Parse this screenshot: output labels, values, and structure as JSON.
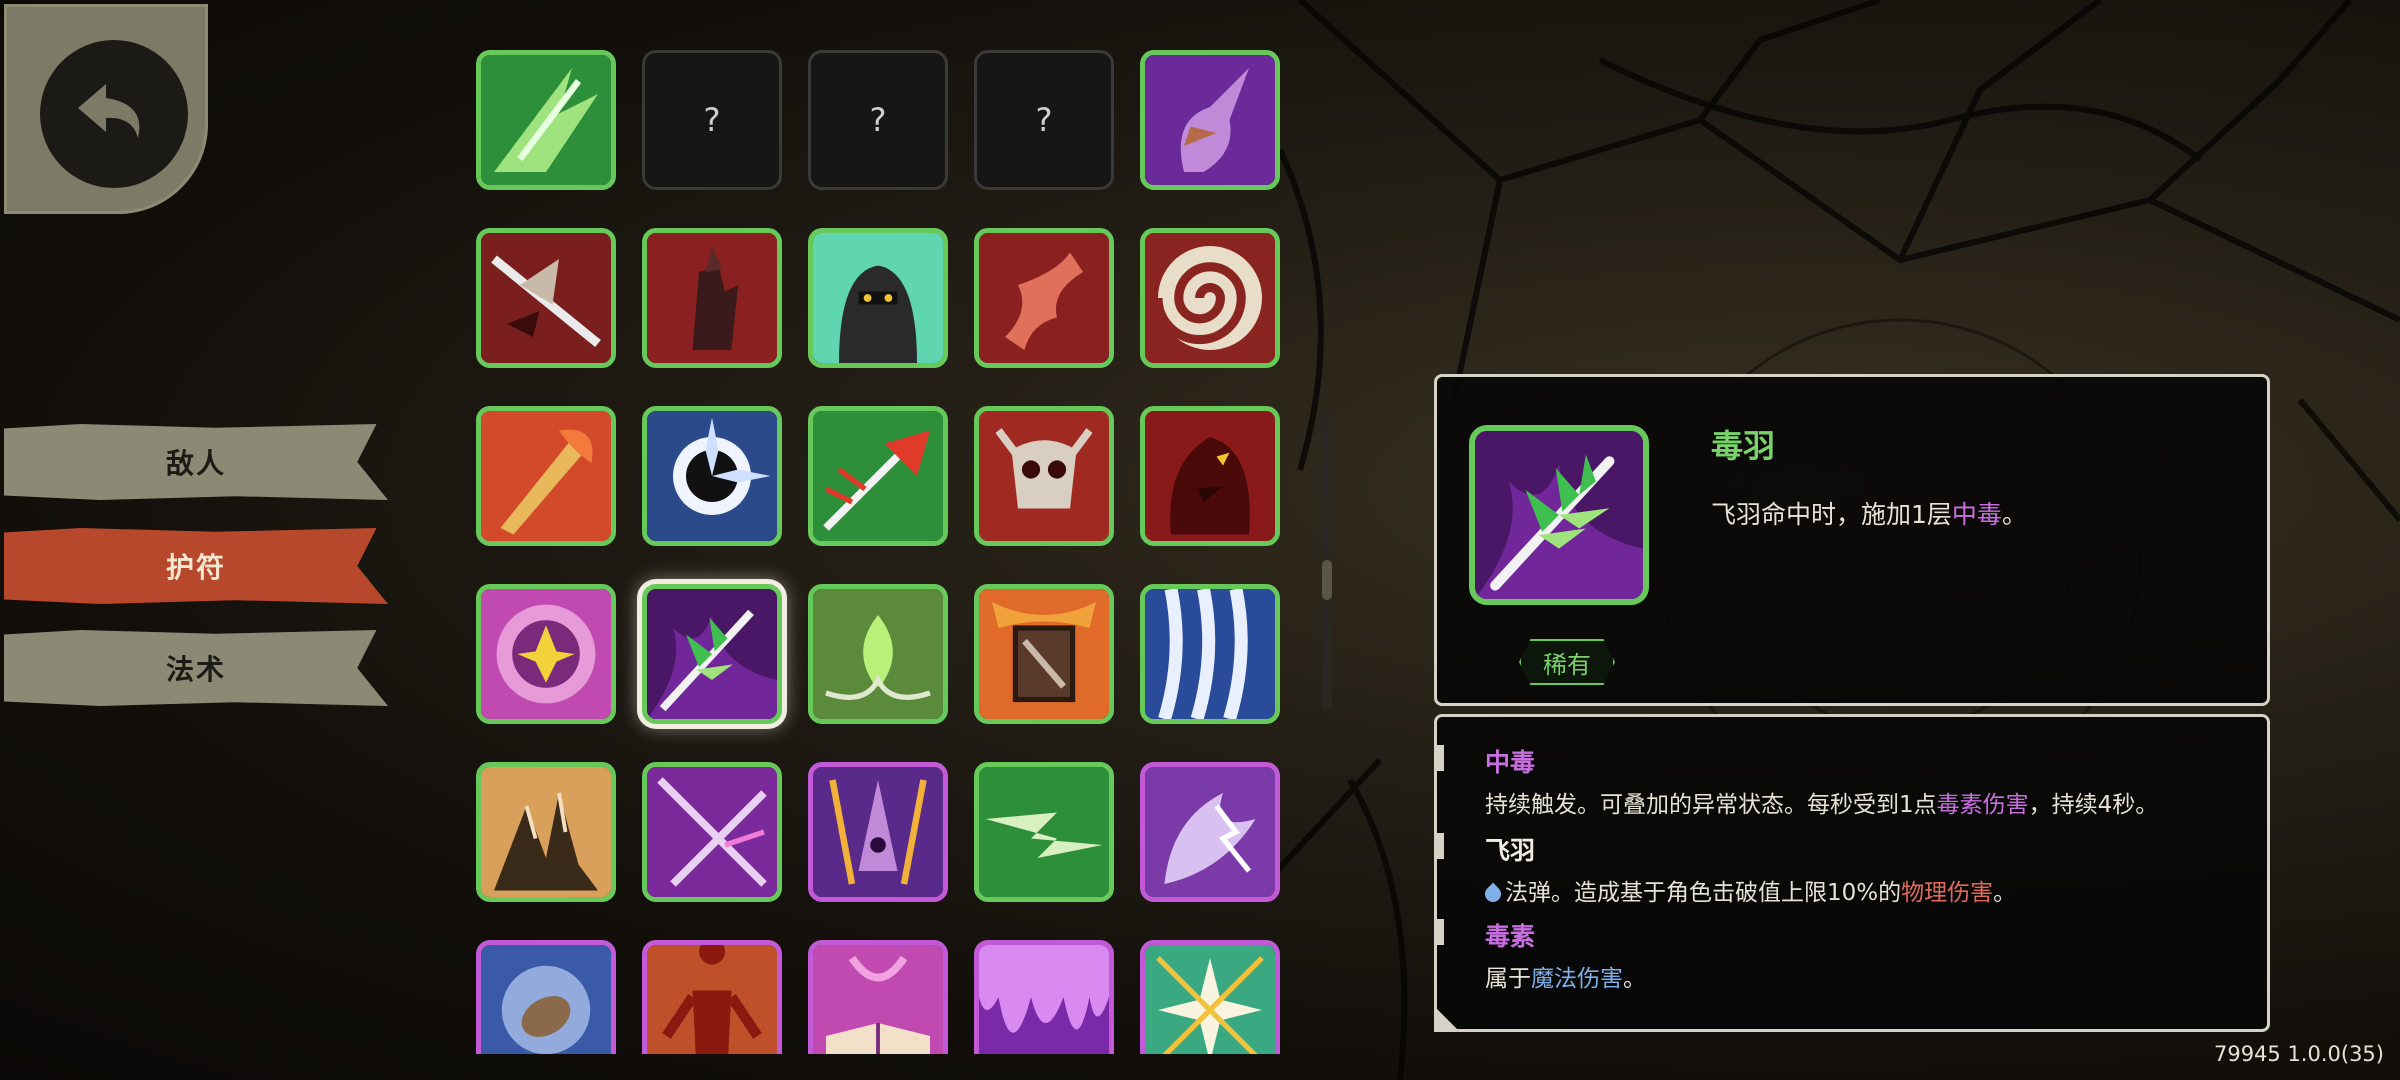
{
  "tabs": [
    {
      "label": "敌人",
      "active": false
    },
    {
      "label": "护符",
      "active": true
    },
    {
      "label": "法术",
      "active": false
    }
  ],
  "grid": {
    "unknown_label": "?",
    "rows": [
      [
        {
          "kind": "icon",
          "border": "green",
          "icon": "green-claw-icon"
        },
        {
          "kind": "unknown"
        },
        {
          "kind": "unknown"
        },
        {
          "kind": "unknown"
        },
        {
          "kind": "icon",
          "border": "green",
          "icon": "purple-hand-icon"
        }
      ],
      [
        {
          "kind": "icon",
          "border": "green",
          "icon": "blade-slash-icon"
        },
        {
          "kind": "icon",
          "border": "green",
          "icon": "dark-hand-icon"
        },
        {
          "kind": "icon",
          "border": "green",
          "icon": "masked-assassin-icon"
        },
        {
          "kind": "icon",
          "border": "green",
          "icon": "twisted-bone-icon"
        },
        {
          "kind": "icon",
          "border": "green",
          "icon": "spiral-icon"
        }
      ],
      [
        {
          "kind": "icon",
          "border": "green",
          "icon": "flame-sword-icon"
        },
        {
          "kind": "icon",
          "border": "green",
          "icon": "frost-burst-icon"
        },
        {
          "kind": "icon",
          "border": "green",
          "icon": "red-arrow-icon"
        },
        {
          "kind": "icon",
          "border": "green",
          "icon": "demon-skull-icon"
        },
        {
          "kind": "icon",
          "border": "green",
          "icon": "beast-head-icon"
        }
      ],
      [
        {
          "kind": "icon",
          "border": "green",
          "icon": "star-rune-icon"
        },
        {
          "kind": "icon",
          "border": "green",
          "icon": "poison-feather-icon",
          "selected": true
        },
        {
          "kind": "icon",
          "border": "green",
          "icon": "green-flame-icon"
        },
        {
          "kind": "icon",
          "border": "green",
          "icon": "fire-card-icon"
        },
        {
          "kind": "icon",
          "border": "green",
          "icon": "waterfall-icon"
        }
      ],
      [
        {
          "kind": "icon",
          "border": "green",
          "icon": "rock-spike-icon"
        },
        {
          "kind": "icon",
          "border": "green",
          "icon": "crossed-blades-icon"
        },
        {
          "kind": "icon",
          "border": "purple",
          "icon": "arcane-spire-icon"
        },
        {
          "kind": "icon",
          "border": "green",
          "icon": "green-lightning-icon"
        },
        {
          "kind": "icon",
          "border": "purple",
          "icon": "storm-claw-icon"
        }
      ],
      [
        {
          "kind": "icon",
          "border": "purple",
          "icon": "frost-seed-icon"
        },
        {
          "kind": "icon",
          "border": "purple",
          "icon": "flayed-figure-icon"
        },
        {
          "kind": "icon",
          "border": "purple",
          "icon": "spellbook-icon"
        },
        {
          "kind": "icon",
          "border": "purple",
          "icon": "dripping-slime-icon"
        },
        {
          "kind": "icon",
          "border": "purple",
          "icon": "radiant-star-icon"
        }
      ]
    ]
  },
  "detail": {
    "icon": "poison-feather-icon",
    "title": "毒羽",
    "rarity": "稀有",
    "desc_prefix": "飞羽命中时，施加1层",
    "desc_keyword": "中毒",
    "desc_suffix": "。"
  },
  "glossary": {
    "t1": "中毒",
    "d1_prefix": "持续触发。可叠加的异常状态。每秒受到1点",
    "d1_keyword": "毒素伤害",
    "d1_suffix": "，持续4秒。",
    "t2": "飞羽",
    "d2_prefix": "法弹。造成基于角色击破值上限10%的",
    "d2_keyword": "物理伤害",
    "d2_suffix": "。",
    "t3": "毒素",
    "d3_prefix": "属于",
    "d3_keyword": "魔法伤害",
    "d3_suffix": "。"
  },
  "version": "79945 1.0.0(35)",
  "colors": {
    "rarity_green": "#79d36a",
    "border_green": "#67c95a",
    "border_purple": "#c25ad8",
    "keyword_purple": "#c86fe0",
    "keyword_red": "#e06a5a",
    "keyword_blue": "#7fb0e8",
    "tab_active": "#b8482c",
    "tab_inactive": "#8c8a75"
  }
}
